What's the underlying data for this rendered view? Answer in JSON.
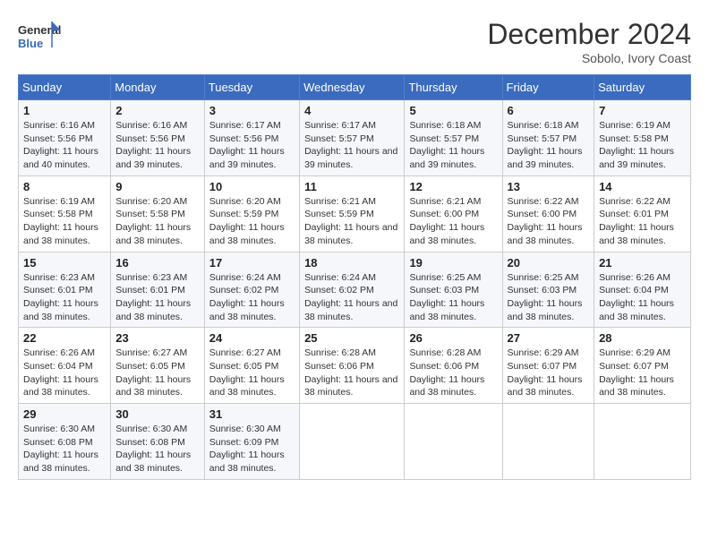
{
  "header": {
    "logo_line1": "General",
    "logo_line2": "Blue",
    "month": "December 2024",
    "location": "Sobolo, Ivory Coast"
  },
  "weekdays": [
    "Sunday",
    "Monday",
    "Tuesday",
    "Wednesday",
    "Thursday",
    "Friday",
    "Saturday"
  ],
  "weeks": [
    [
      {
        "day": "1",
        "sunrise": "6:16 AM",
        "sunset": "5:56 PM",
        "daylight": "11 hours and 40 minutes."
      },
      {
        "day": "2",
        "sunrise": "6:16 AM",
        "sunset": "5:56 PM",
        "daylight": "11 hours and 39 minutes."
      },
      {
        "day": "3",
        "sunrise": "6:17 AM",
        "sunset": "5:56 PM",
        "daylight": "11 hours and 39 minutes."
      },
      {
        "day": "4",
        "sunrise": "6:17 AM",
        "sunset": "5:57 PM",
        "daylight": "11 hours and 39 minutes."
      },
      {
        "day": "5",
        "sunrise": "6:18 AM",
        "sunset": "5:57 PM",
        "daylight": "11 hours and 39 minutes."
      },
      {
        "day": "6",
        "sunrise": "6:18 AM",
        "sunset": "5:57 PM",
        "daylight": "11 hours and 39 minutes."
      },
      {
        "day": "7",
        "sunrise": "6:19 AM",
        "sunset": "5:58 PM",
        "daylight": "11 hours and 39 minutes."
      }
    ],
    [
      {
        "day": "8",
        "sunrise": "6:19 AM",
        "sunset": "5:58 PM",
        "daylight": "11 hours and 38 minutes."
      },
      {
        "day": "9",
        "sunrise": "6:20 AM",
        "sunset": "5:58 PM",
        "daylight": "11 hours and 38 minutes."
      },
      {
        "day": "10",
        "sunrise": "6:20 AM",
        "sunset": "5:59 PM",
        "daylight": "11 hours and 38 minutes."
      },
      {
        "day": "11",
        "sunrise": "6:21 AM",
        "sunset": "5:59 PM",
        "daylight": "11 hours and 38 minutes."
      },
      {
        "day": "12",
        "sunrise": "6:21 AM",
        "sunset": "6:00 PM",
        "daylight": "11 hours and 38 minutes."
      },
      {
        "day": "13",
        "sunrise": "6:22 AM",
        "sunset": "6:00 PM",
        "daylight": "11 hours and 38 minutes."
      },
      {
        "day": "14",
        "sunrise": "6:22 AM",
        "sunset": "6:01 PM",
        "daylight": "11 hours and 38 minutes."
      }
    ],
    [
      {
        "day": "15",
        "sunrise": "6:23 AM",
        "sunset": "6:01 PM",
        "daylight": "11 hours and 38 minutes."
      },
      {
        "day": "16",
        "sunrise": "6:23 AM",
        "sunset": "6:01 PM",
        "daylight": "11 hours and 38 minutes."
      },
      {
        "day": "17",
        "sunrise": "6:24 AM",
        "sunset": "6:02 PM",
        "daylight": "11 hours and 38 minutes."
      },
      {
        "day": "18",
        "sunrise": "6:24 AM",
        "sunset": "6:02 PM",
        "daylight": "11 hours and 38 minutes."
      },
      {
        "day": "19",
        "sunrise": "6:25 AM",
        "sunset": "6:03 PM",
        "daylight": "11 hours and 38 minutes."
      },
      {
        "day": "20",
        "sunrise": "6:25 AM",
        "sunset": "6:03 PM",
        "daylight": "11 hours and 38 minutes."
      },
      {
        "day": "21",
        "sunrise": "6:26 AM",
        "sunset": "6:04 PM",
        "daylight": "11 hours and 38 minutes."
      }
    ],
    [
      {
        "day": "22",
        "sunrise": "6:26 AM",
        "sunset": "6:04 PM",
        "daylight": "11 hours and 38 minutes."
      },
      {
        "day": "23",
        "sunrise": "6:27 AM",
        "sunset": "6:05 PM",
        "daylight": "11 hours and 38 minutes."
      },
      {
        "day": "24",
        "sunrise": "6:27 AM",
        "sunset": "6:05 PM",
        "daylight": "11 hours and 38 minutes."
      },
      {
        "day": "25",
        "sunrise": "6:28 AM",
        "sunset": "6:06 PM",
        "daylight": "11 hours and 38 minutes."
      },
      {
        "day": "26",
        "sunrise": "6:28 AM",
        "sunset": "6:06 PM",
        "daylight": "11 hours and 38 minutes."
      },
      {
        "day": "27",
        "sunrise": "6:29 AM",
        "sunset": "6:07 PM",
        "daylight": "11 hours and 38 minutes."
      },
      {
        "day": "28",
        "sunrise": "6:29 AM",
        "sunset": "6:07 PM",
        "daylight": "11 hours and 38 minutes."
      }
    ],
    [
      {
        "day": "29",
        "sunrise": "6:30 AM",
        "sunset": "6:08 PM",
        "daylight": "11 hours and 38 minutes."
      },
      {
        "day": "30",
        "sunrise": "6:30 AM",
        "sunset": "6:08 PM",
        "daylight": "11 hours and 38 minutes."
      },
      {
        "day": "31",
        "sunrise": "6:30 AM",
        "sunset": "6:09 PM",
        "daylight": "11 hours and 38 minutes."
      },
      null,
      null,
      null,
      null
    ]
  ]
}
